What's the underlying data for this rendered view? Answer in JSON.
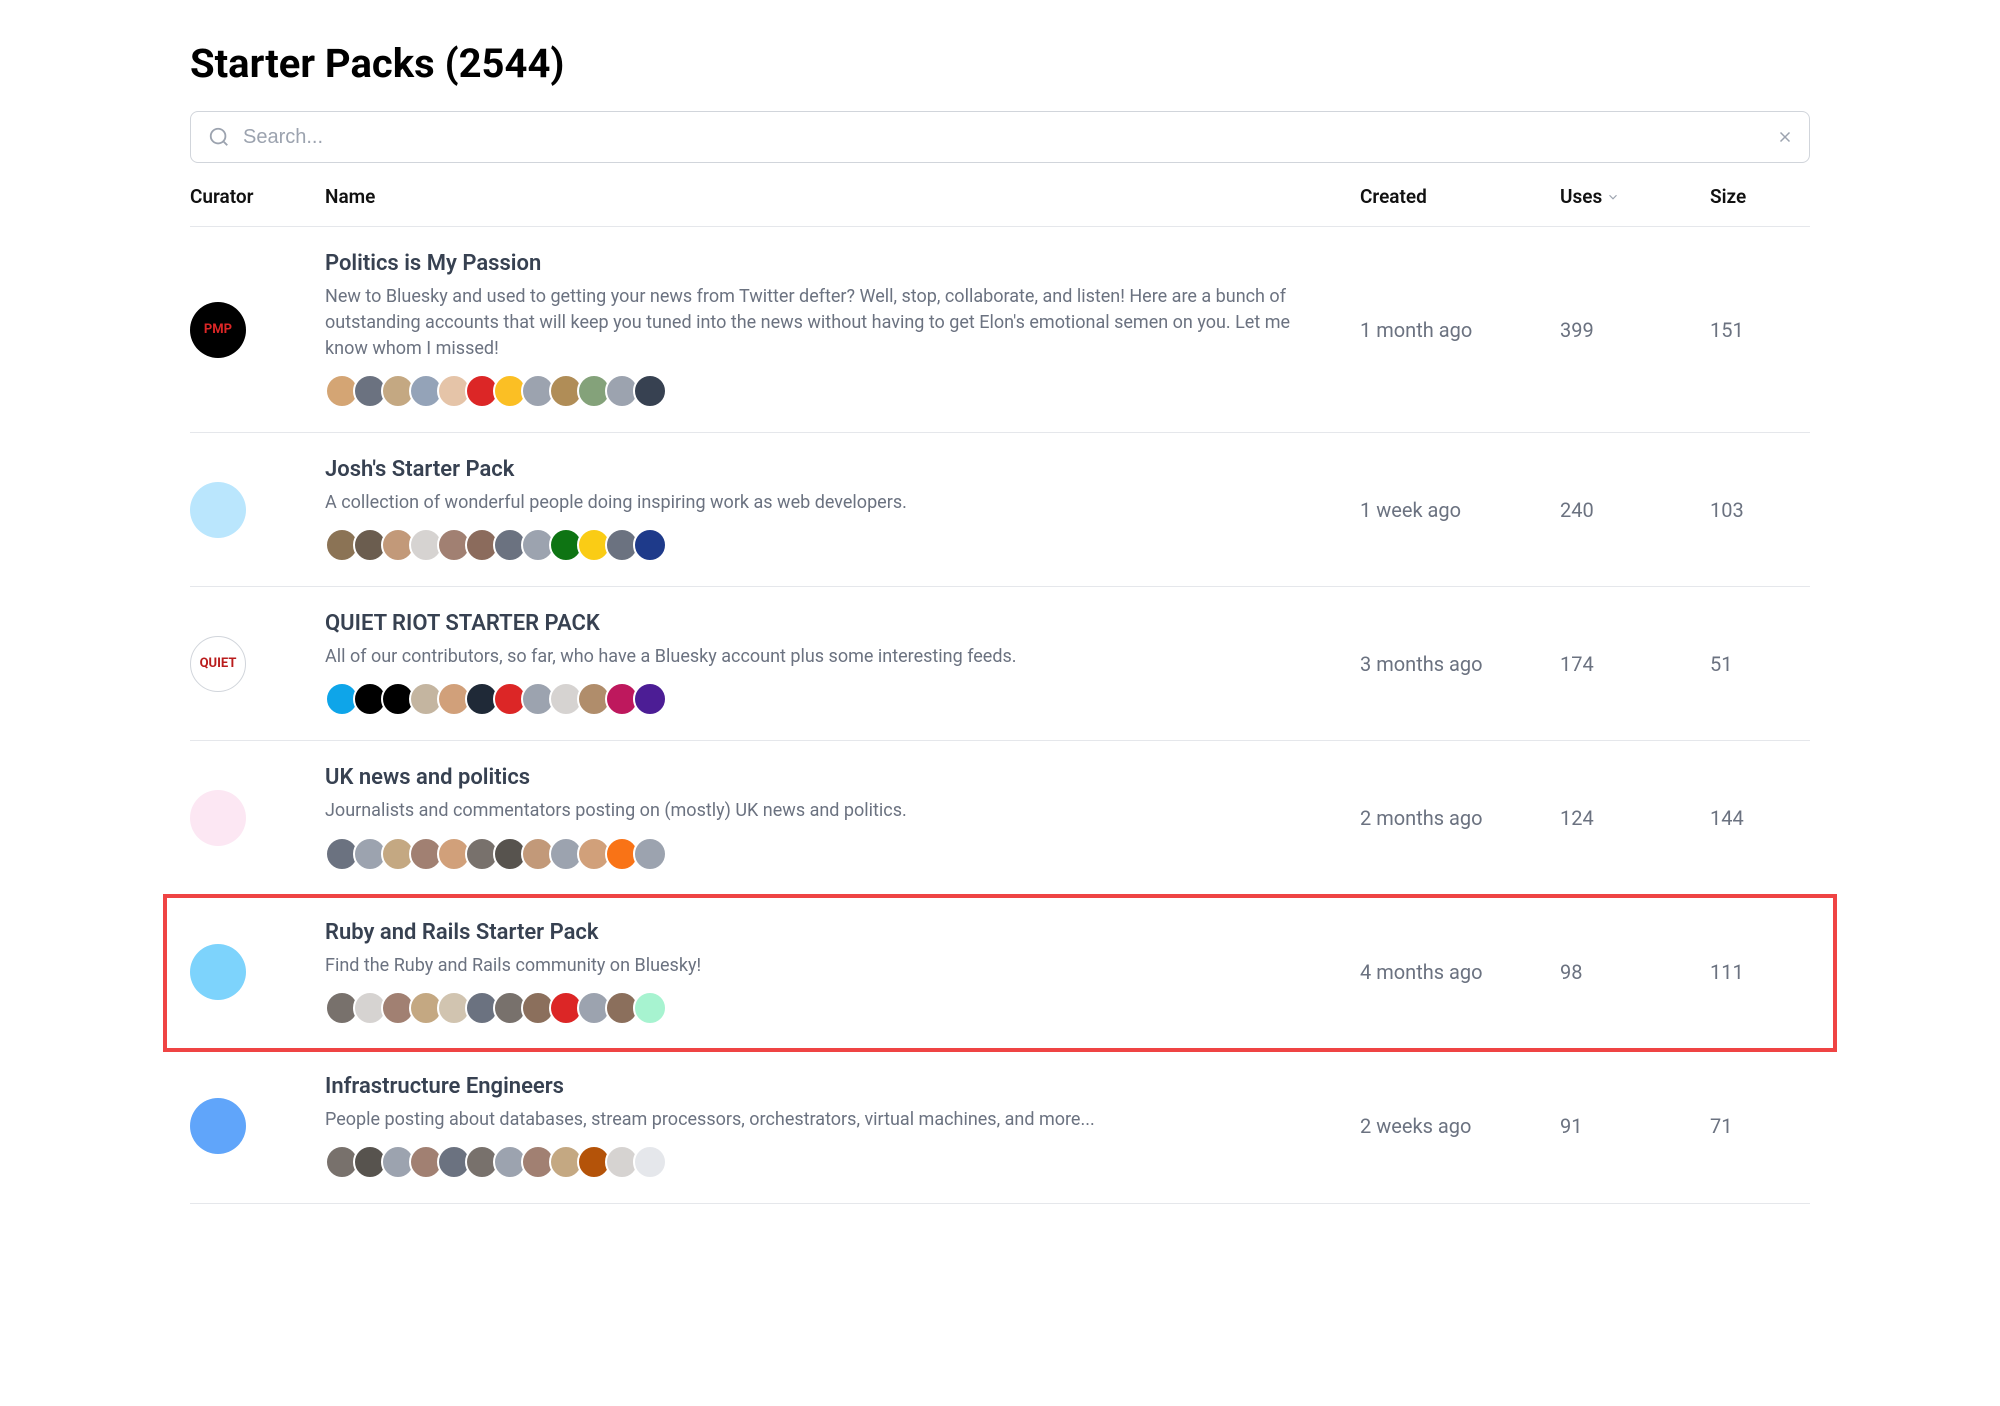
{
  "page": {
    "title_prefix": "Starter Packs",
    "count": "2544"
  },
  "search": {
    "placeholder": "Search..."
  },
  "columns": {
    "curator": "Curator",
    "name": "Name",
    "created": "Created",
    "uses": "Uses",
    "size": "Size"
  },
  "rows": [
    {
      "highlighted": false,
      "curator_color": "#000",
      "curator_text": "PMP",
      "curator_text_color": "#dc2626",
      "title": "Politics is My Passion",
      "desc": "New to Bluesky and used to getting your news from Twitter defter? Well, stop, collaborate, and listen! Here are a bunch of outstanding accounts that will keep you tuned into the news without having to get Elon's emotional semen on you. Let me know whom I missed!",
      "created": "1 month ago",
      "uses": "399",
      "size": "151",
      "avatars": [
        "#d4a574",
        "#6b7280",
        "#c4a882",
        "#94a3b8",
        "#e5c4a8",
        "#dc2626",
        "#fbbf24",
        "#9ca3af",
        "#b08d57",
        "#84a27a",
        "#9ca3af",
        "#374151"
      ]
    },
    {
      "highlighted": false,
      "curator_color": "#bae6fd",
      "curator_text": "",
      "title": "Josh's Starter Pack",
      "desc": "A collection of wonderful people doing inspiring work as web developers.",
      "created": "1 week ago",
      "uses": "240",
      "size": "103",
      "avatars": [
        "#8b7355",
        "#6b5d4f",
        "#c29979",
        "#d6d3d1",
        "#a18072",
        "#8b6b5c",
        "#6b7280",
        "#9ca3af",
        "#0e7413",
        "#facc15",
        "#6b7280",
        "#1e3a8a"
      ]
    },
    {
      "highlighted": false,
      "curator_color": "#fff",
      "curator_border": true,
      "curator_text": "QUIET",
      "curator_text_color": "#b91c1c",
      "title": "QUIET RIOT STARTER PACK",
      "desc": "All of our contributors, so far, who have a Bluesky account plus some interesting feeds.",
      "created": "3 months ago",
      "uses": "174",
      "size": "51",
      "avatars": [
        "#0ea5e9",
        "#000",
        "#000",
        "#c4b5a0",
        "#d1a07a",
        "#1f2937",
        "#dc2626",
        "#9ca3af",
        "#d6d3d1",
        "#b08d6b",
        "#be185d",
        "#4c1d95"
      ]
    },
    {
      "highlighted": false,
      "curator_color": "#fce7f3",
      "curator_text": "",
      "title": "UK news and politics",
      "desc": "Journalists and commentators posting on (mostly) UK news and politics.",
      "created": "2 months ago",
      "uses": "124",
      "size": "144",
      "avatars": [
        "#6b7280",
        "#9ca3af",
        "#c4a882",
        "#a18072",
        "#d1a07a",
        "#78716c",
        "#57534e",
        "#c29979",
        "#9ca3af",
        "#d1a07a",
        "#f97316",
        "#9ca3af"
      ]
    },
    {
      "highlighted": true,
      "curator_color": "#7dd3fc",
      "curator_text": "",
      "title": "Ruby and Rails Starter Pack",
      "desc": "Find the Ruby and Rails community on Bluesky!",
      "created": "4 months ago",
      "uses": "98",
      "size": "111",
      "avatars": [
        "#78716c",
        "#d6d3d1",
        "#a18072",
        "#c4a882",
        "#d1c4b0",
        "#6b7280",
        "#78716c",
        "#8b6f5c",
        "#dc2626",
        "#9ca3af",
        "#8b6f5c",
        "#a7f3d0"
      ]
    },
    {
      "highlighted": false,
      "curator_color": "#60a5fa",
      "curator_text": "",
      "title": "Infrastructure Engineers",
      "desc": "People posting about databases, stream processors, orchestrators, virtual machines, and more...",
      "created": "2 weeks ago",
      "uses": "91",
      "size": "71",
      "avatars": [
        "#78716c",
        "#57534e",
        "#9ca3af",
        "#a18072",
        "#6b7280",
        "#78716c",
        "#9ca3af",
        "#a18072",
        "#c4a882",
        "#b45309",
        "#d6d3d1",
        "#e5e7eb"
      ]
    }
  ]
}
